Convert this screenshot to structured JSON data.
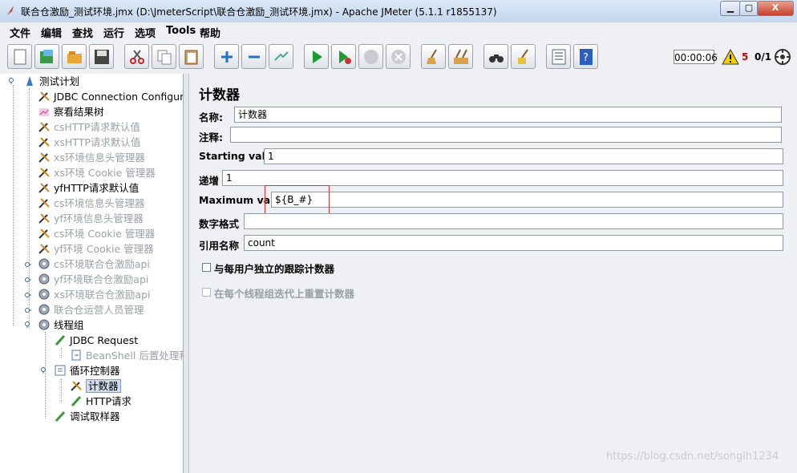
{
  "window": {
    "title": "联合仓激励_测试环境.jmx (D:\\JmeterScript\\联合仓激励_测试环境.jmx) - Apache JMeter (5.1.1 r1855137)",
    "controls": {
      "minimize": "▁",
      "maximize": "▢",
      "close": "X"
    }
  },
  "menubar": [
    "文件",
    "编辑",
    "查找",
    "运行",
    "选项",
    "Tools",
    "帮助"
  ],
  "toolbar": {
    "buttons": [
      "new-icon",
      "templates-icon",
      "open-icon",
      "save-icon",
      "cut-icon",
      "copy-icon",
      "paste-icon",
      "expand-icon",
      "collapse-icon",
      "toggle-icon",
      "start-icon",
      "start-no-pause-icon",
      "stop-icon",
      "shutdown-icon",
      "clear-icon",
      "clear-all-icon",
      "search-icon",
      "reset-search-icon",
      "function-helper-icon",
      "help-icon"
    ],
    "timer": "00:00:06",
    "warning_count": "5",
    "threads": "0/1"
  },
  "tree": [
    {
      "label": "测试计划",
      "icon": "test-plan-icon",
      "enabled": true
    },
    {
      "label": "JDBC Connection Configura",
      "icon": "config-element-icon",
      "enabled": true
    },
    {
      "label": "察看结果树",
      "icon": "listener-icon",
      "enabled": true
    },
    {
      "label": "csHTTP请求默认值",
      "icon": "config-element-icon",
      "enabled": false
    },
    {
      "label": "xsHTTP请求默认值",
      "icon": "config-element-icon",
      "enabled": false
    },
    {
      "label": "xs环境信息头管理器",
      "icon": "config-element-icon",
      "enabled": false
    },
    {
      "label": "xs环境 Cookie 管理器",
      "icon": "config-element-icon",
      "enabled": false
    },
    {
      "label": "yfHTTP请求默认值",
      "icon": "config-element-icon",
      "enabled": true
    },
    {
      "label": "cs环境信息头管理器",
      "icon": "config-element-icon",
      "enabled": false
    },
    {
      "label": "yf环境信息头管理器",
      "icon": "config-element-icon",
      "enabled": false
    },
    {
      "label": "cs环境 Cookie 管理器",
      "icon": "config-element-icon",
      "enabled": false
    },
    {
      "label": "yf环境 Cookie 管理器",
      "icon": "config-element-icon",
      "enabled": false
    },
    {
      "label": "cs环境联合仓激励api",
      "icon": "thread-group-icon",
      "enabled": false
    },
    {
      "label": "yf环境联合仓激励api",
      "icon": "thread-group-icon",
      "enabled": false
    },
    {
      "label": "xs环境联合仓激励api",
      "icon": "thread-group-icon",
      "enabled": false
    },
    {
      "label": "联合仓运营人员管理",
      "icon": "thread-group-icon",
      "enabled": false
    },
    {
      "label": "线程组",
      "icon": "thread-group-icon",
      "enabled": true
    },
    {
      "label": "JDBC Request",
      "icon": "sampler-icon",
      "enabled": true
    },
    {
      "label": "BeanShell 后置处理程",
      "icon": "post-processor-icon",
      "enabled": false
    },
    {
      "label": "循环控制器",
      "icon": "controller-icon",
      "enabled": true
    },
    {
      "label": "计数器",
      "icon": "config-element-icon",
      "enabled": true,
      "selected": true
    },
    {
      "label": "HTTP请求",
      "icon": "sampler-icon",
      "enabled": true
    },
    {
      "label": "调试取样器",
      "icon": "sampler-icon",
      "enabled": true
    }
  ],
  "panel": {
    "title": "计数器",
    "name_label": "名称:",
    "name_value": "计数器",
    "comment_label": "注释:",
    "comment_value": "",
    "start_label": "Starting value",
    "start_value": "1",
    "increment_label": "递增",
    "increment_value": "1",
    "max_label": "Maximum value",
    "max_value": "${B_#}",
    "format_label": "数字格式",
    "format_value": "",
    "refname_label": "引用名称",
    "refname_value": "count",
    "per_user_label": "与每用户独立的跟踪计数器",
    "per_user_checked": false,
    "reset_label": "在每个线程组迭代上重置计数器",
    "reset_checked": false
  },
  "watermark": "https://blog.csdn.net/songlh1234"
}
